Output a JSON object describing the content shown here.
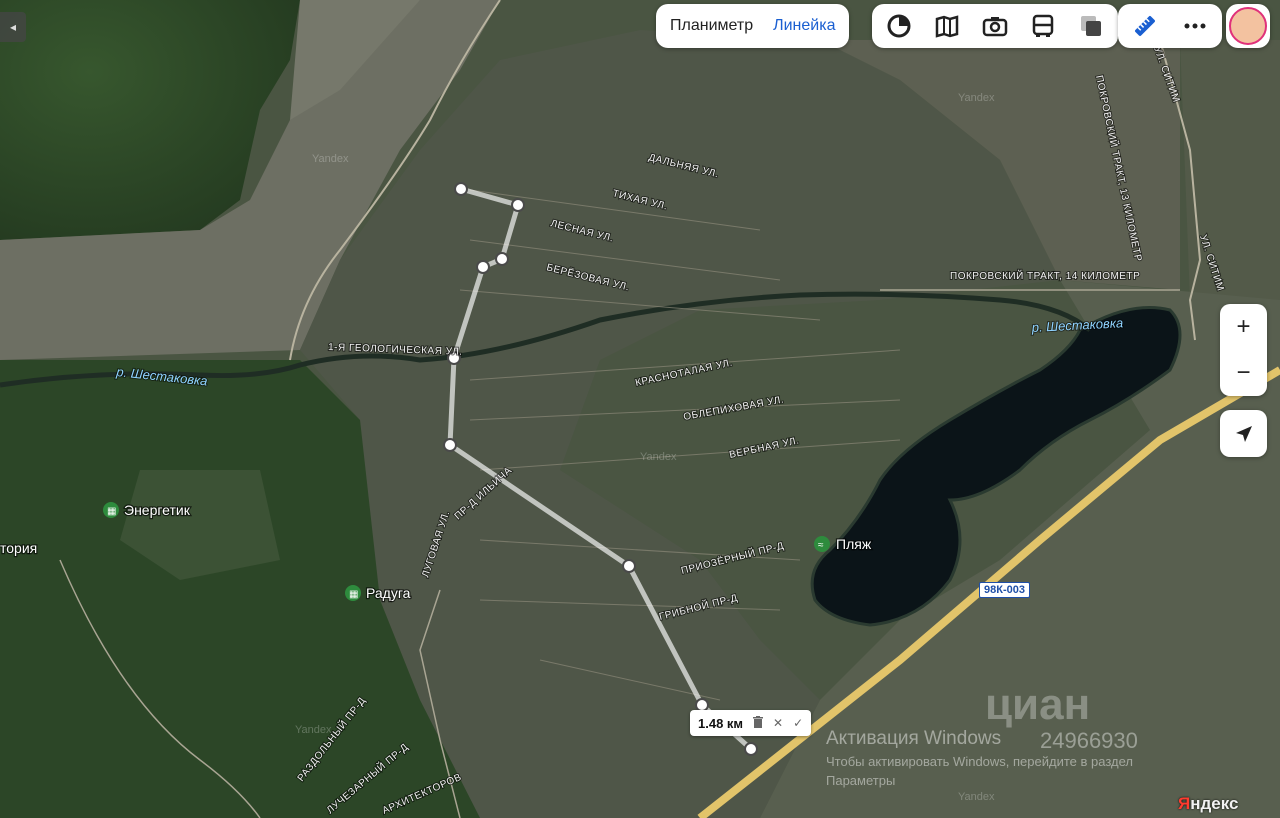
{
  "toolbar": {
    "modes": [
      "Планиметр",
      "Линейка"
    ],
    "active_mode": "Линейка",
    "layer_icons": [
      "circle-icon",
      "map-book-icon",
      "camera-icon",
      "bus-icon",
      "layers-icon"
    ],
    "ruler_icon": "ruler-icon",
    "more_icon": "more-icon"
  },
  "controls": {
    "zoom_in": "+",
    "zoom_out": "−",
    "back": "◂"
  },
  "map": {
    "streets": [
      "ДАЛЬНЯЯ УЛ.",
      "ТИХАЯ УЛ.",
      "ЛЕСНАЯ УЛ.",
      "БЕРЁЗОВАЯ УЛ.",
      "1-Я ГЕОЛОГИЧЕСКАЯ УЛ.",
      "КРАСНОТАЛАЯ УЛ.",
      "ОБЛЕПИХОВАЯ УЛ.",
      "ВЕРБНАЯ УЛ.",
      "ПРИОЗЁРНЫЙ ПР-Д",
      "ГРИБНОЙ ПР-Д",
      "ЛУГОВАЯ УЛ.",
      "ПР-Д ИЛЬИЧА",
      "РАЗДОЛЬНЫЙ ПР-Д",
      "ЛУЧЕЗАРНЫЙ ПР-Д",
      "АРХИТЕКТОРОВ",
      "ПОКРОВСКИЙ ТРАКТ, 14 КИЛОМЕТР",
      "ПОКРОВСКИЙ ТРАКТ, 13 КИЛОМЕТР",
      "УЛ. СИТИМ",
      "УЛ. СИТИМ"
    ],
    "river": "р. Шестаковка",
    "river2": "р. Шестаковка",
    "places": [
      "Энергетик",
      "Радуга",
      "Пляж"
    ],
    "partial_place": "тория",
    "road_number": "98К-003",
    "watermarks": [
      "Yandex",
      "Yandex",
      "Yandex",
      "Yandex",
      "Yandex"
    ]
  },
  "measurement": {
    "distance": "1.48 км",
    "delete_icon": "trash-icon",
    "close": "✕",
    "confirm": "✓"
  },
  "overlay": {
    "windows_activation_title": "Активация Windows",
    "windows_activation_sub": "Чтобы активировать Windows, перейдите в раздел",
    "windows_activation_sub2": "Параметры",
    "ad_id": "24966930",
    "cian": "циан"
  },
  "logo": {
    "first": "Я",
    "rest": "ндекс"
  },
  "colors": {
    "accent": "#1a5fd1",
    "route_line": "#d9d9d9",
    "water": "#0b1418",
    "road": "#e2c46a"
  }
}
